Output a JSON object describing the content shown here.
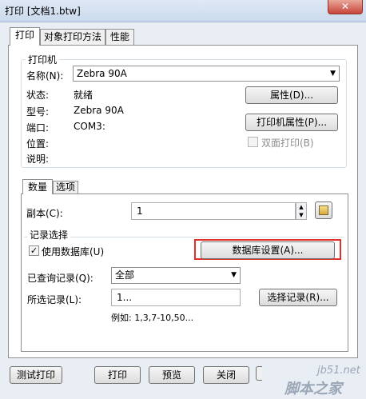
{
  "window": {
    "title": "打印 [文档1.btw]",
    "close_glyph": "✕"
  },
  "tabs": [
    "打印",
    "对象打印方法",
    "性能"
  ],
  "printer": {
    "group_label": "打印机",
    "name_label": "名称(N):",
    "name_value": "Zebra 90A",
    "status_label": "状态:",
    "status_value": "就绪",
    "model_label": "型号:",
    "model_value": "Zebra 90A",
    "port_label": "端口:",
    "port_value": "COM3:",
    "location_label": "位置:",
    "comment_label": "说明:",
    "properties_button": "属性(D)...",
    "printer_properties_button": "打印机属性(P)...",
    "duplex_label": "双面打印(B)",
    "duplex_checked": false
  },
  "subtabs": [
    "数量",
    "选项"
  ],
  "quantity": {
    "copies_label": "副本(C):",
    "copies_value": "1"
  },
  "records": {
    "group_label": "记录选择",
    "use_database_label": "使用数据库(U)",
    "use_database_checked": true,
    "database_settings_button": "数据库设置(A)...",
    "queried_label": "已查询记录(Q):",
    "queried_value": "全部",
    "selected_label": "所选记录(L):",
    "selected_value": "1...",
    "select_records_button": "选择记录(R)...",
    "example_text": "例如:  1,3,7-10,50..."
  },
  "footer": {
    "test_print_button": "测试打印",
    "print_button": "打印",
    "preview_button": "预览",
    "close_button": "关闭"
  },
  "watermark": {
    "line1": "jb51.net",
    "line2": "脚本之家"
  },
  "colors": {
    "highlight": "#e0302a",
    "window_bg": "#e9eef5"
  }
}
